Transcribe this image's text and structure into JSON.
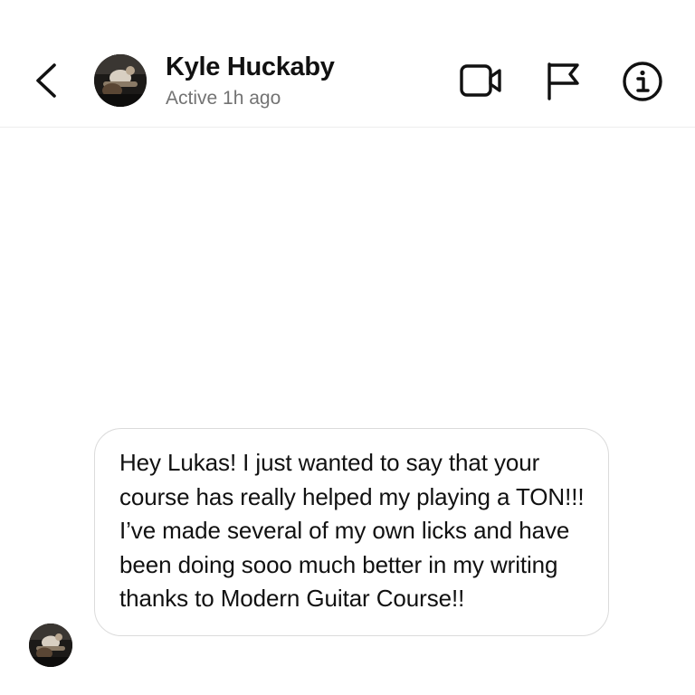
{
  "header": {
    "contact_name": "Kyle Huckaby",
    "status": "Active 1h ago",
    "icons": {
      "back": "chevron-left-icon",
      "video": "video-camera-icon",
      "flag": "flag-icon",
      "info": "info-icon"
    }
  },
  "messages": [
    {
      "sender": "Kyle Huckaby",
      "text": "Hey Lukas! I just wanted to say that your course has really helped my playing a TON!!! I’ve made several of my own licks and have been doing sooo much better in my writing thanks to Modern Guitar Course!!"
    }
  ],
  "colors": {
    "background": "#ffffff",
    "text": "#111111",
    "secondary_text": "#737373",
    "bubble_border": "#dbdbdb"
  }
}
